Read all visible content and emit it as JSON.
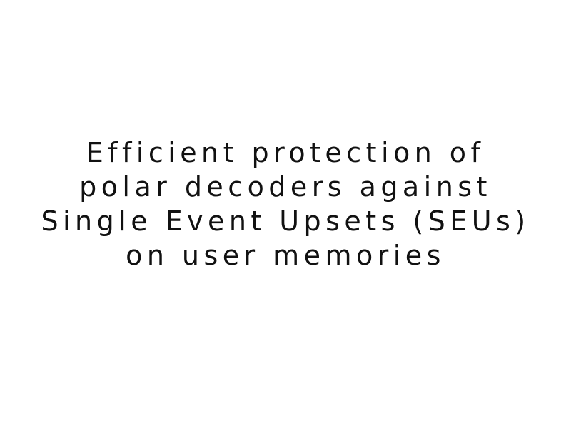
{
  "slide": {
    "title_lines": [
      " Efficient protection of",
      "polar decoders against",
      "Single Event Upsets (SEUs)",
      "on user memories"
    ]
  }
}
